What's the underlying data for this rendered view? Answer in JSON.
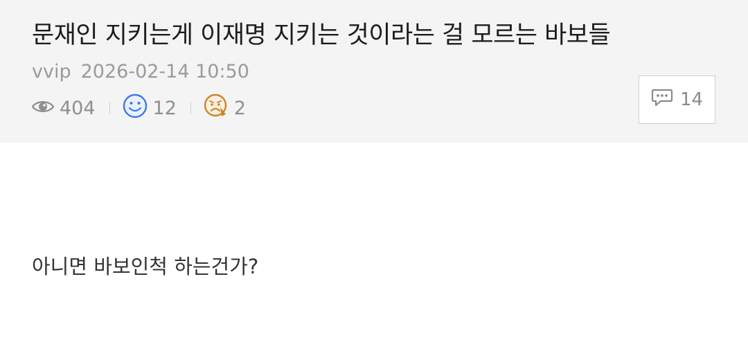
{
  "post": {
    "title": "문재인 지키는게 이재명 지키는 것이라는 걸 모르는 바보들",
    "author": "vvip",
    "datetime": "2026-02-14 10:50",
    "stats": {
      "views": "404",
      "likes": "12",
      "dislikes": "2"
    },
    "comments": "14",
    "body": "아니면 바보인척 하는건가?"
  },
  "icons": {
    "views": "eye-icon",
    "likes": "smile-face-icon",
    "dislikes": "sad-face-icon",
    "comments": "speech-bubble-icon"
  },
  "colors": {
    "header_bg": "#f4f4f4",
    "like_blue": "#3b78e7",
    "dislike_orange": "#c8862a"
  }
}
